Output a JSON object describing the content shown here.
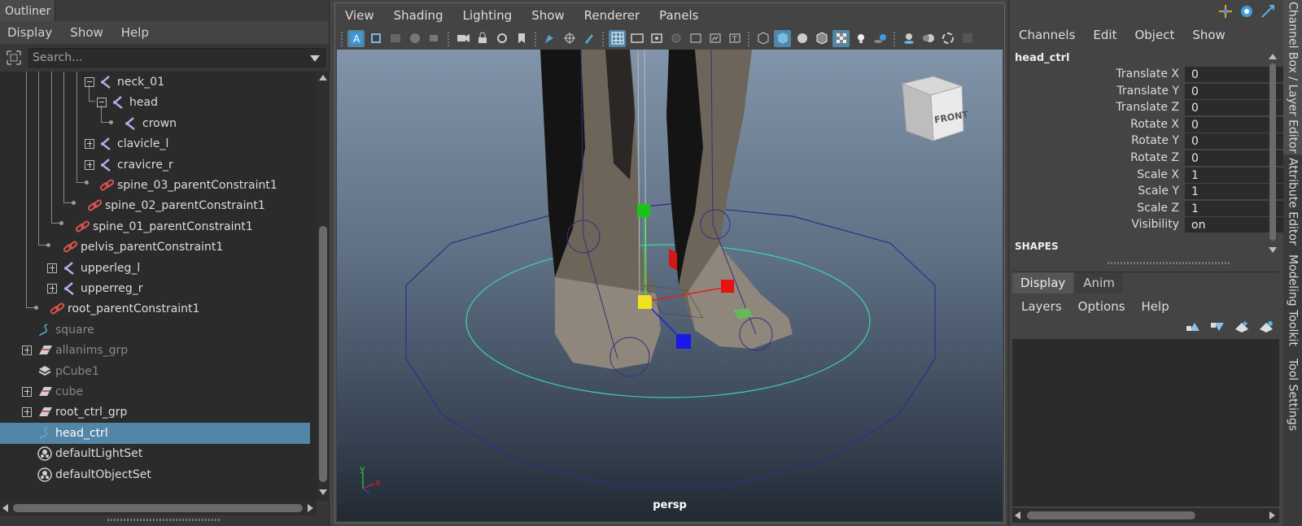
{
  "colors": {
    "selection": "#5285a6",
    "panel": "#444444",
    "field": "#2b2b2b",
    "text": "#d2d2d2",
    "constraint_icon": "#d9534f",
    "joint_icon": "#b9a6e8"
  },
  "outliner": {
    "title": "Outliner",
    "menu": [
      "Display",
      "Show",
      "Help"
    ],
    "search_placeholder": "Search...",
    "rows": [
      {
        "label": "neck_01",
        "icon": "joint-icon",
        "expand": "minus"
      },
      {
        "label": "head",
        "icon": "joint-icon",
        "expand": "minus"
      },
      {
        "label": "crown",
        "icon": "joint-icon",
        "expand": ""
      },
      {
        "label": "clavicle_l",
        "icon": "joint-icon",
        "expand": "plus"
      },
      {
        "label": "cravicre_r",
        "icon": "joint-icon",
        "expand": "plus"
      },
      {
        "label": "spine_03_parentConstraint1",
        "icon": "constraint-icon",
        "expand": ""
      },
      {
        "label": "spine_02_parentConstraint1",
        "icon": "constraint-icon",
        "expand": ""
      },
      {
        "label": "spine_01_parentConstraint1",
        "icon": "constraint-icon",
        "expand": ""
      },
      {
        "label": "pelvis_parentConstraint1",
        "icon": "constraint-icon",
        "expand": ""
      },
      {
        "label": "upperleg_l",
        "icon": "joint-icon",
        "expand": "plus"
      },
      {
        "label": "upperreg_r",
        "icon": "joint-icon",
        "expand": "plus"
      },
      {
        "label": "root_parentConstraint1",
        "icon": "constraint-icon",
        "expand": ""
      },
      {
        "label": "square",
        "icon": "curve-icon",
        "expand": "",
        "dim": true
      },
      {
        "label": "allanims_grp",
        "icon": "group-icon",
        "expand": "plus",
        "dim": true
      },
      {
        "label": "pCube1",
        "icon": "mesh-icon",
        "expand": "",
        "dim": true
      },
      {
        "label": "cube",
        "icon": "group-icon",
        "expand": "plus",
        "dim": true
      },
      {
        "label": "root_ctrl_grp",
        "icon": "group-icon",
        "expand": "plus"
      },
      {
        "label": "head_ctrl",
        "icon": "curve-icon",
        "expand": "",
        "selected": true
      },
      {
        "label": "defaultLightSet",
        "icon": "set-icon",
        "expand": ""
      },
      {
        "label": "defaultObjectSet",
        "icon": "set-icon",
        "expand": ""
      }
    ]
  },
  "viewport": {
    "menu": [
      "View",
      "Shading",
      "Lighting",
      "Show",
      "Renderer",
      "Panels"
    ],
    "camera_label": "persp",
    "viewcube_label": "FRONT",
    "axis_x": "x",
    "axis_y": "y"
  },
  "channel_box": {
    "menu": [
      "Channels",
      "Edit",
      "Object",
      "Show"
    ],
    "object_name": "head_ctrl",
    "attributes": [
      {
        "name": "Translate X",
        "value": "0"
      },
      {
        "name": "Translate Y",
        "value": "0"
      },
      {
        "name": "Translate Z",
        "value": "0"
      },
      {
        "name": "Rotate X",
        "value": "0"
      },
      {
        "name": "Rotate Y",
        "value": "0"
      },
      {
        "name": "Rotate Z",
        "value": "0"
      },
      {
        "name": "Scale X",
        "value": "1"
      },
      {
        "name": "Scale Y",
        "value": "1"
      },
      {
        "name": "Scale Z",
        "value": "1"
      },
      {
        "name": "Visibility",
        "value": "on"
      }
    ],
    "shapes_header": "SHAPES"
  },
  "layer_editor": {
    "tabs": [
      "Display",
      "Anim"
    ],
    "menu": [
      "Layers",
      "Options",
      "Help"
    ]
  },
  "side_tabs": [
    "Channel Box / Layer Editor",
    "Attribute Editor",
    "Modeling Toolkit",
    "Tool Settings"
  ]
}
